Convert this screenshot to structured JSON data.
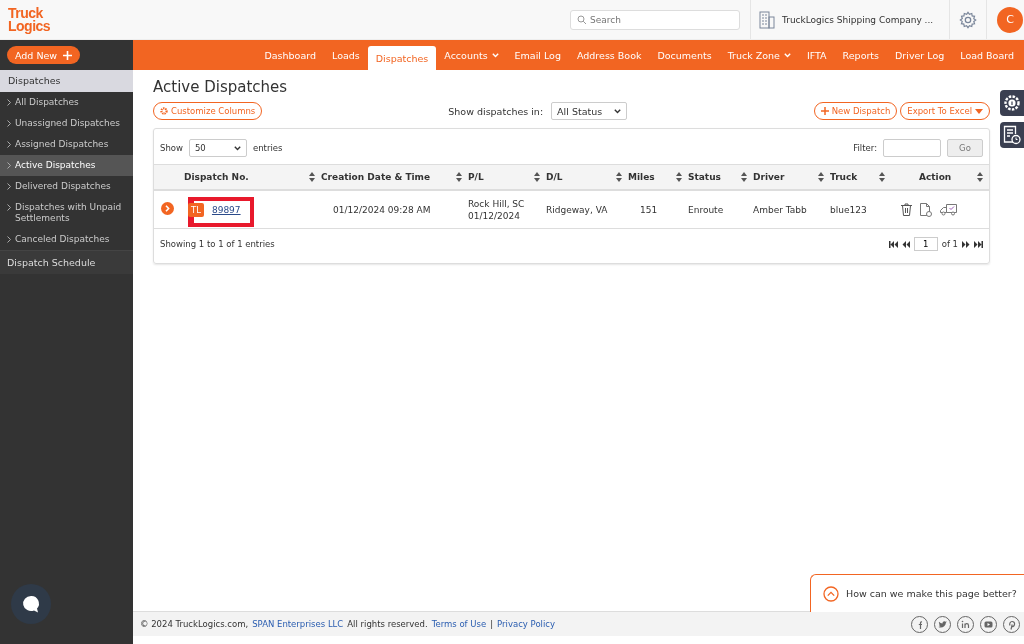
{
  "header": {
    "logo": {
      "line1": "Truck",
      "line2": "Logics"
    },
    "search": {
      "placeholder": "Search"
    },
    "company": "TruckLogics Shipping Company ...",
    "avatar": "C"
  },
  "add_new": "Add New",
  "nav": [
    {
      "label": "Dashboard",
      "selected": false,
      "dropdown": false
    },
    {
      "label": "Loads",
      "selected": false,
      "dropdown": false
    },
    {
      "label": "Dispatches",
      "selected": true,
      "dropdown": false
    },
    {
      "label": "Accounts",
      "selected": false,
      "dropdown": true
    },
    {
      "label": "Email Log",
      "selected": false,
      "dropdown": false
    },
    {
      "label": "Address Book",
      "selected": false,
      "dropdown": false
    },
    {
      "label": "Documents",
      "selected": false,
      "dropdown": false
    },
    {
      "label": "Truck Zone",
      "selected": false,
      "dropdown": true
    },
    {
      "label": "IFTA",
      "selected": false,
      "dropdown": false
    },
    {
      "label": "Reports",
      "selected": false,
      "dropdown": false
    },
    {
      "label": "Driver Log",
      "selected": false,
      "dropdown": false
    },
    {
      "label": "Load Board",
      "selected": false,
      "dropdown": false
    }
  ],
  "sidebar": {
    "section": "Dispatches",
    "items": [
      {
        "label": "All Dispatches",
        "selected": false
      },
      {
        "label": "Unassigned Dispatches",
        "selected": false
      },
      {
        "label": "Assigned Dispatches",
        "selected": false
      },
      {
        "label": "Active Dispatches",
        "selected": true
      },
      {
        "label": "Delivered Dispatches",
        "selected": false
      },
      {
        "label": "Dispatches with Unpaid Settlements",
        "selected": false
      },
      {
        "label": "Canceled Dispatches",
        "selected": false
      }
    ],
    "bottom": "Dispatch Schedule"
  },
  "page": {
    "title": "Active Dispatches",
    "customize": "Customize Columns",
    "status_label": "Show dispatches in:",
    "status_value": "All Status",
    "new_dispatch": "New Dispatch",
    "export": "Export To Excel"
  },
  "table": {
    "show": "Show",
    "length": "50",
    "entries": "entries",
    "filter_label": "Filter:",
    "go": "Go",
    "columns": [
      "Dispatch No.",
      "Creation Date & Time",
      "P/L",
      "D/L",
      "Miles",
      "Status",
      "Driver",
      "Truck",
      "Action"
    ],
    "rows": [
      {
        "type": "TL",
        "number": "89897",
        "highlighted": true,
        "created": "01/12/2024 09:28 AM",
        "pl": [
          "Rock Hill, SC",
          "01/12/2024"
        ],
        "dl": "Ridgeway, VA",
        "miles": "151",
        "status": "Enroute",
        "driver": "Amber Tabb",
        "truck": "blue123"
      }
    ],
    "info": "Showing 1 to 1 of 1 entries",
    "page": "1",
    "of": "of 1"
  },
  "footer": {
    "copyright": "© 2024 TruckLogics.com,",
    "company_link": "SPAN Enterprises LLC",
    "rights": "All rights reserved.",
    "terms": "Terms of Use",
    "separator": "|",
    "privacy": "Privacy Policy"
  },
  "feedback": "How can we make this page better?"
}
